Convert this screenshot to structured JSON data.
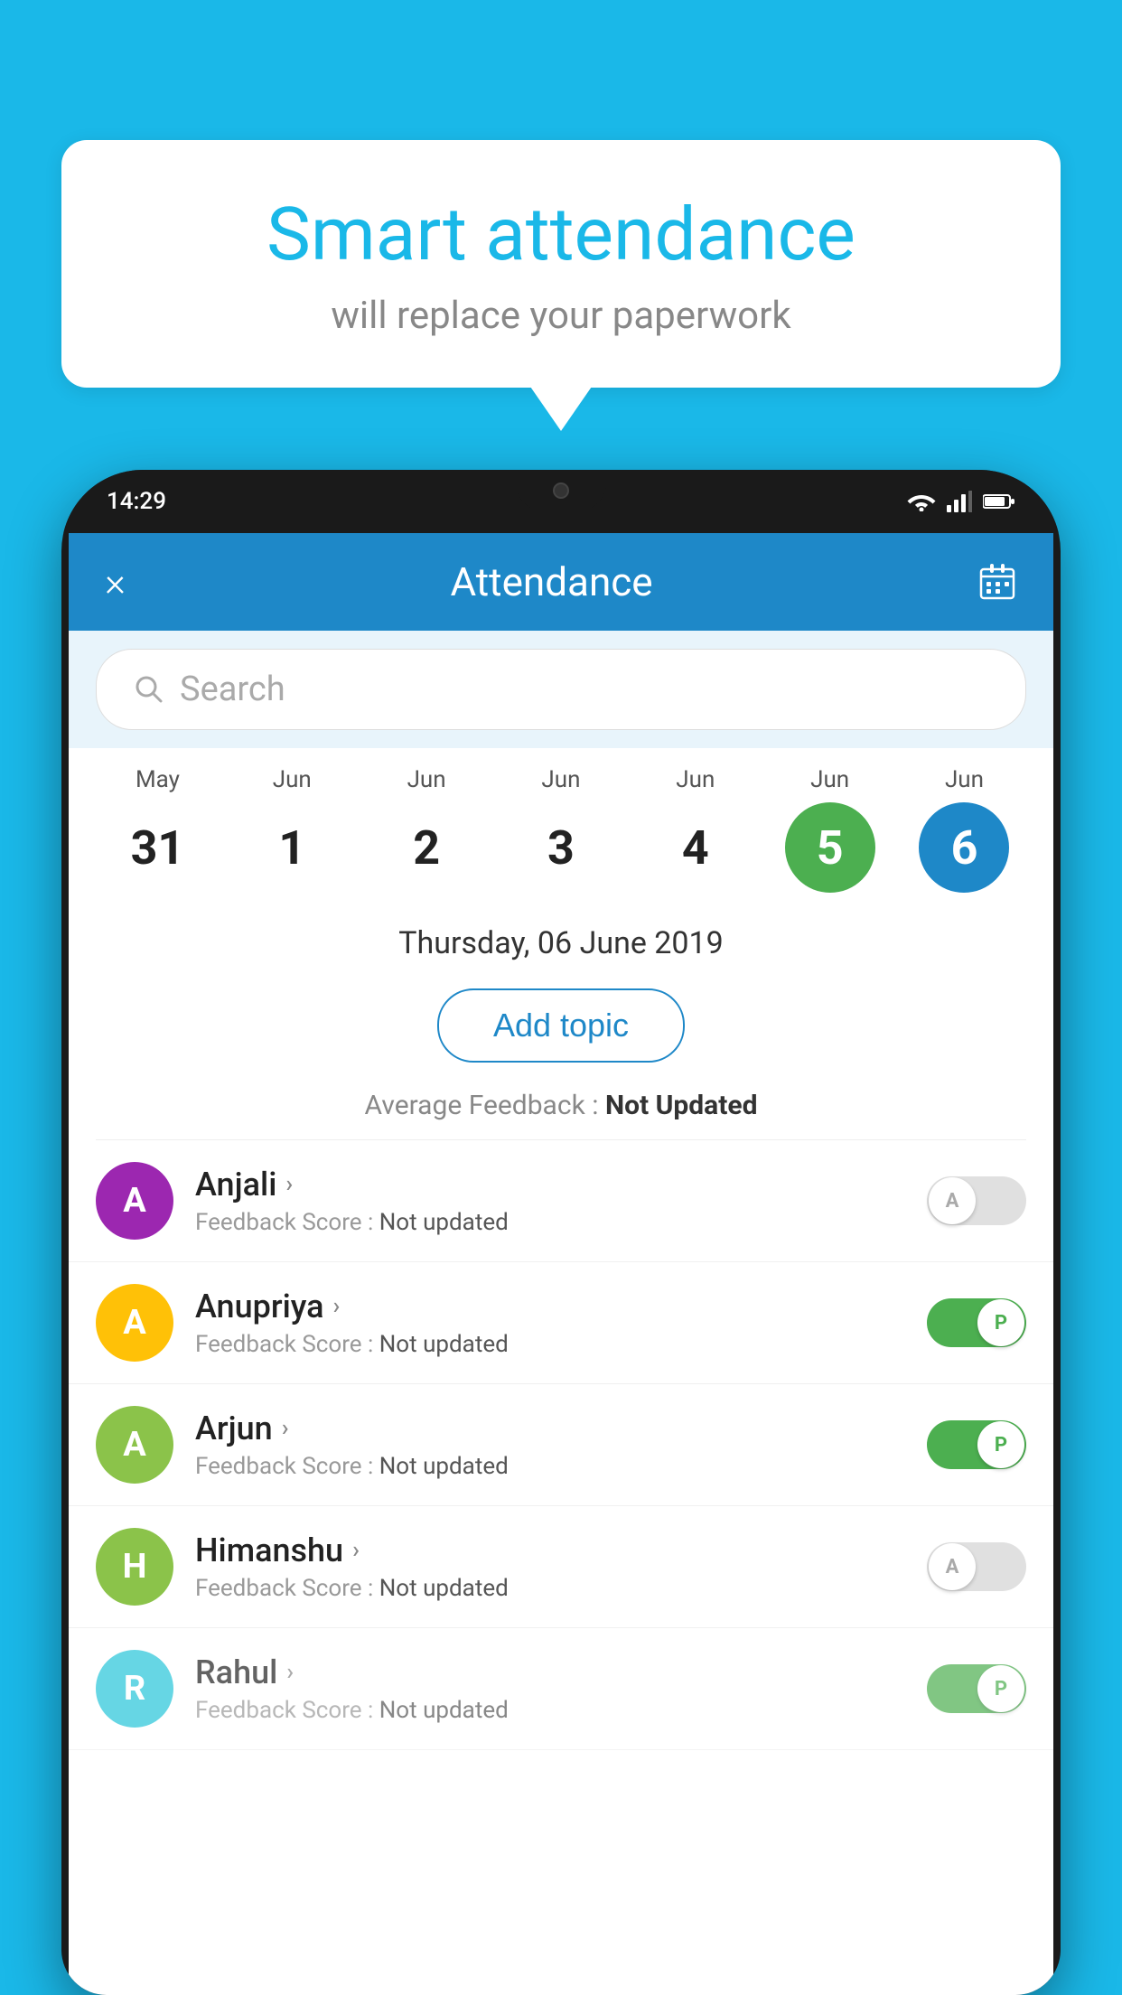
{
  "page": {
    "bg_color": "#1ab8e8"
  },
  "speech_bubble": {
    "title": "Smart attendance",
    "subtitle": "will replace your paperwork"
  },
  "status_bar": {
    "time": "14:29"
  },
  "header": {
    "close_label": "×",
    "title": "Attendance"
  },
  "search": {
    "placeholder": "Search"
  },
  "dates": [
    {
      "month": "May",
      "day": "31",
      "style": "normal"
    },
    {
      "month": "Jun",
      "day": "1",
      "style": "normal"
    },
    {
      "month": "Jun",
      "day": "2",
      "style": "normal"
    },
    {
      "month": "Jun",
      "day": "3",
      "style": "normal"
    },
    {
      "month": "Jun",
      "day": "4",
      "style": "normal"
    },
    {
      "month": "Jun",
      "day": "5",
      "style": "today"
    },
    {
      "month": "Jun",
      "day": "6",
      "style": "selected"
    }
  ],
  "selected_date": {
    "label": "Thursday, 06 June 2019"
  },
  "add_topic_button": "Add topic",
  "average_feedback": {
    "label": "Average Feedback : ",
    "value": "Not Updated"
  },
  "students": [
    {
      "name": "Anjali",
      "avatar_letter": "A",
      "avatar_color": "#9c27b0",
      "feedback_label": "Feedback Score : ",
      "feedback_value": "Not updated",
      "attendance": "A",
      "present": false
    },
    {
      "name": "Anupriya",
      "avatar_letter": "A",
      "avatar_color": "#ffc107",
      "feedback_label": "Feedback Score : ",
      "feedback_value": "Not updated",
      "attendance": "P",
      "present": true
    },
    {
      "name": "Arjun",
      "avatar_letter": "A",
      "avatar_color": "#8bc34a",
      "feedback_label": "Feedback Score : ",
      "feedback_value": "Not updated",
      "attendance": "P",
      "present": true
    },
    {
      "name": "Himanshu",
      "avatar_letter": "H",
      "avatar_color": "#8bc34a",
      "feedback_label": "Feedback Score : ",
      "feedback_value": "Not updated",
      "attendance": "A",
      "present": false
    },
    {
      "name": "Rahul",
      "avatar_letter": "R",
      "avatar_color": "#26c6da",
      "feedback_label": "Feedback Score : ",
      "feedback_value": "Not updated",
      "attendance": "P",
      "present": true
    }
  ]
}
